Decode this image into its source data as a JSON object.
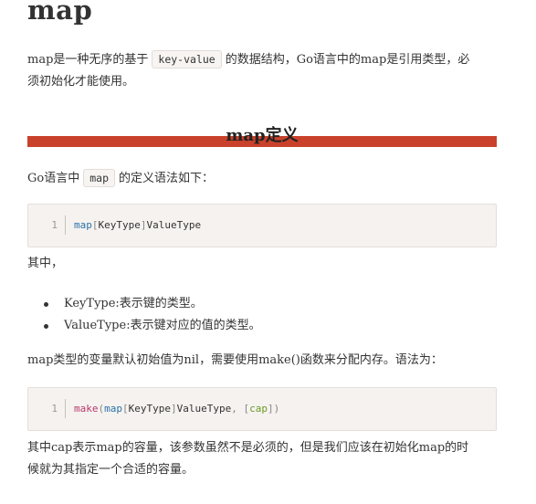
{
  "title": "map",
  "intro": {
    "before": "map是一种无序的基于",
    "code": "key-value",
    "after_line1": "的数据结构，Go语言中的map是引用类型，必",
    "line2": "须初始化才能使用。"
  },
  "section_heading": "map定义",
  "syntax_intro": {
    "before": "Go语言中",
    "code": "map",
    "after": "的定义语法如下："
  },
  "code_block_1": {
    "line_number": "1",
    "tokens": [
      "map",
      "[",
      "KeyType",
      "]",
      "ValueType"
    ]
  },
  "where_label": "其中，",
  "bullets": [
    "KeyType:表示键的类型。",
    "ValueType:表示键对应的值的类型。"
  ],
  "default_text": "map类型的变量默认初始值为nil，需要使用make()函数来分配内存。语法为：",
  "code_block_2": {
    "line_number": "1",
    "tokens": [
      "make",
      "(",
      "map",
      "[",
      "KeyType",
      "]",
      "ValueType",
      ", ",
      "[",
      "cap",
      "]",
      ")"
    ]
  },
  "cap_text": {
    "line1": "其中cap表示map的容量，该参数虽然不是必须的，但是我们应该在初始化map的时",
    "line2": "候就为其指定一个合适的容量。"
  }
}
